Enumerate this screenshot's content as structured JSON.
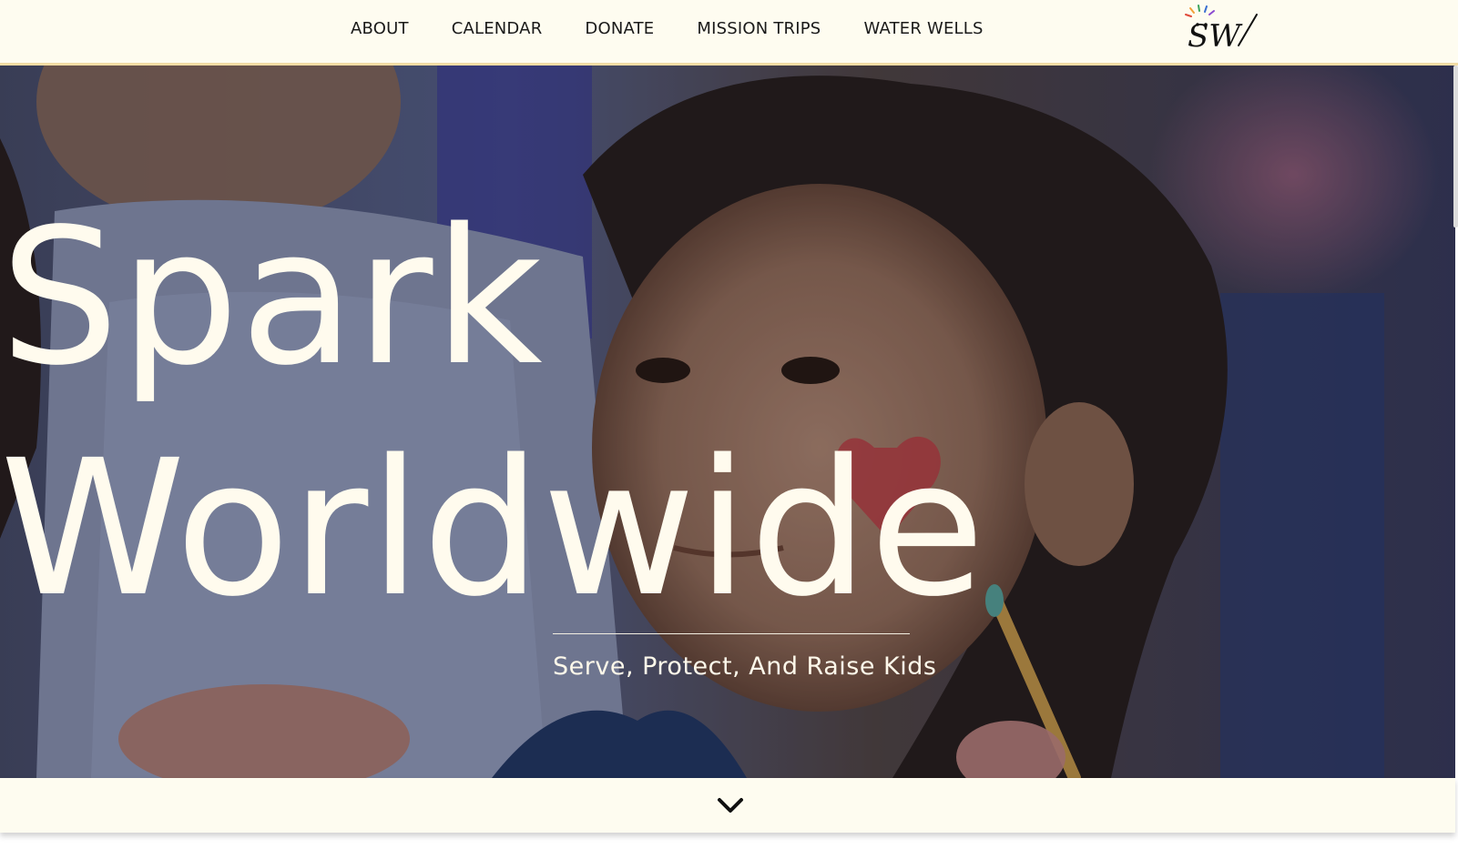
{
  "nav": {
    "items": [
      {
        "label": "ABOUT"
      },
      {
        "label": "CALENDAR"
      },
      {
        "label": "DONATE"
      },
      {
        "label": "MISSION TRIPS"
      },
      {
        "label": "WATER WELLS"
      }
    ]
  },
  "logo": {
    "icon": "spark-worldwide-logo-icon",
    "text": "SW"
  },
  "hero": {
    "title_line1": "Spark",
    "title_line2": "Worldwide",
    "tagline": "Serve, Protect, And Raise Kids"
  },
  "scroll": {
    "icon": "chevron-down-icon"
  },
  "colors": {
    "background": "#fefcf0",
    "header_border": "#f2dca4",
    "hero_text": "#fffbee",
    "nav_text": "#1a1a1a"
  }
}
